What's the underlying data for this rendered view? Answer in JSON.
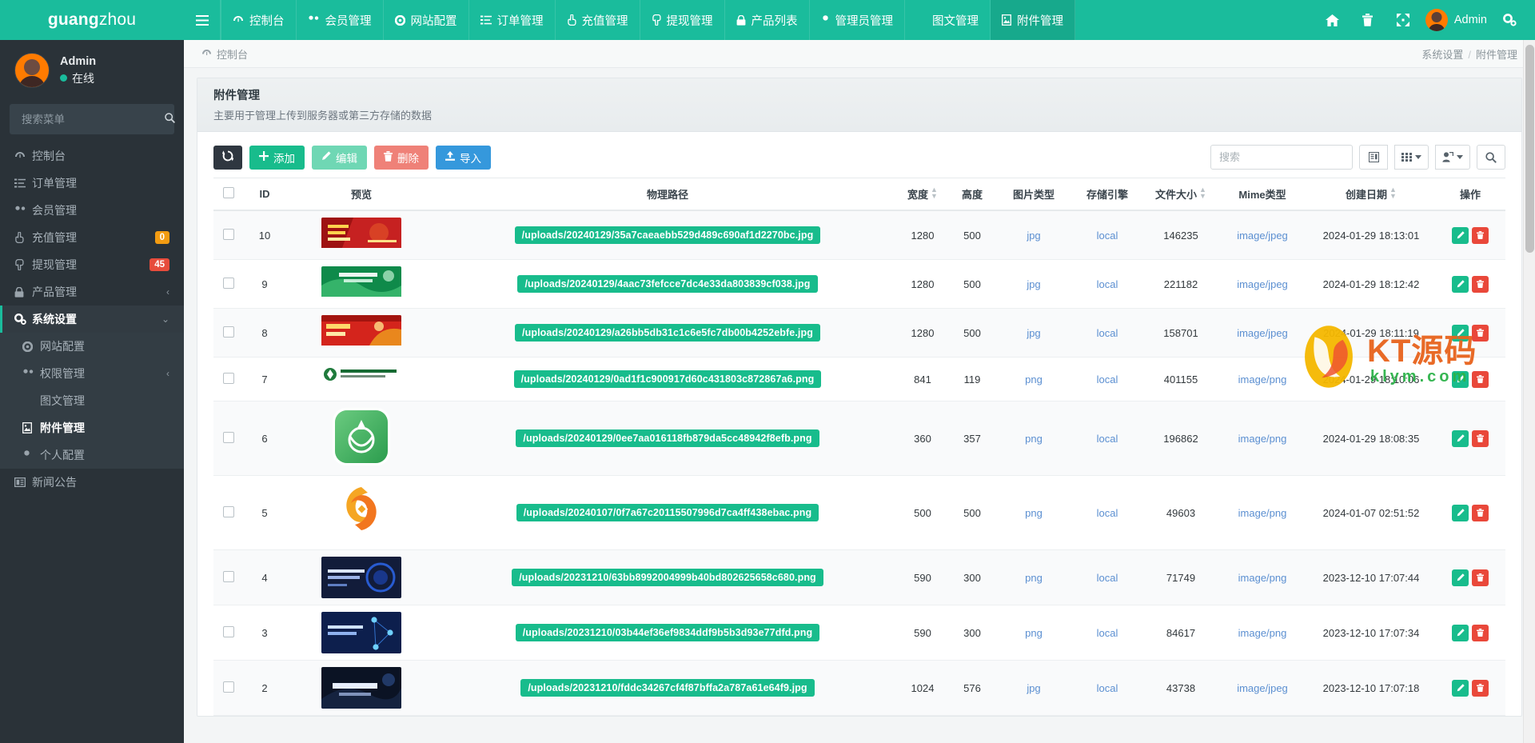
{
  "brand": {
    "bold": "guang",
    "light": "zhou"
  },
  "topnav": {
    "menu_icon": "hamburger-icon",
    "items": [
      {
        "label": "控制台",
        "icon": "dashboard-icon",
        "active": false
      },
      {
        "label": "会员管理",
        "icon": "users-icon",
        "active": false
      },
      {
        "label": "网站配置",
        "icon": "gear-icon",
        "active": false
      },
      {
        "label": "订单管理",
        "icon": "list-icon",
        "active": false
      },
      {
        "label": "充值管理",
        "icon": "hand-up-icon",
        "active": false
      },
      {
        "label": "提现管理",
        "icon": "hand-down-icon",
        "active": false
      },
      {
        "label": "产品列表",
        "icon": "lock-icon",
        "active": false
      },
      {
        "label": "管理员管理",
        "icon": "user-icon",
        "active": false
      },
      {
        "label": "图文管理",
        "icon": "leaf-icon",
        "active": false
      },
      {
        "label": "附件管理",
        "icon": "image-file-icon",
        "active": true
      }
    ],
    "right_icons": [
      "home-icon",
      "trash-icon",
      "fullscreen-icon"
    ],
    "user_name": "Admin",
    "settings_icon": "cogs-icon"
  },
  "sidebar": {
    "user": {
      "name": "Admin",
      "status": "在线"
    },
    "search_placeholder": "搜索菜单",
    "search_value": "",
    "search_icon": "search-icon",
    "items": [
      {
        "label": "控制台",
        "icon": "dashboard-icon",
        "badge": "",
        "caret": "",
        "state": ""
      },
      {
        "label": "订单管理",
        "icon": "list-icon",
        "badge": "",
        "caret": "",
        "state": ""
      },
      {
        "label": "会员管理",
        "icon": "users-icon",
        "badge": "",
        "caret": "",
        "state": ""
      },
      {
        "label": "充值管理",
        "icon": "hand-up-icon",
        "badge": "0",
        "badge_color": "#f39c12",
        "caret": "",
        "state": ""
      },
      {
        "label": "提现管理",
        "icon": "hand-down-icon",
        "badge": "45",
        "badge_color": "#e74c3c",
        "caret": "",
        "state": ""
      },
      {
        "label": "产品管理",
        "icon": "lock-icon",
        "badge": "",
        "caret": "‹",
        "state": ""
      },
      {
        "label": "系统设置",
        "icon": "cogs-icon",
        "badge": "",
        "caret": "⌄",
        "state": "active-parent"
      },
      {
        "label": "网站配置",
        "icon": "gear-icon",
        "badge": "",
        "caret": "",
        "state": "sub"
      },
      {
        "label": "权限管理",
        "icon": "users-icon",
        "badge": "",
        "caret": "‹",
        "state": "sub"
      },
      {
        "label": "图文管理",
        "icon": "leaf-icon",
        "badge": "",
        "caret": "",
        "state": "sub"
      },
      {
        "label": "附件管理",
        "icon": "image-file-icon",
        "badge": "",
        "caret": "",
        "state": "sub on"
      },
      {
        "label": "个人配置",
        "icon": "user-icon",
        "badge": "",
        "caret": "",
        "state": "sub"
      },
      {
        "label": "新闻公告",
        "icon": "news-icon",
        "badge": "",
        "caret": "",
        "state": ""
      }
    ]
  },
  "breadcrumb": {
    "left_icon": "dashboard-icon",
    "left": "控制台",
    "right_first": "系统设置",
    "right_sep": "/",
    "right_last": "附件管理"
  },
  "panel": {
    "title": "附件管理",
    "desc": "主要用于管理上传到服务器或第三方存储的数据"
  },
  "toolbar": {
    "refresh_label": "",
    "refresh_icon": "refresh-icon",
    "add_label": "添加",
    "edit_label": "编辑",
    "delete_label": "删除",
    "import_label": "导入",
    "search_placeholder": "搜索",
    "search_value": "",
    "columns_icon": "columns-icon",
    "grid_icon": "grid-icon",
    "export_icon": "export-icon",
    "search_icon": "search-icon"
  },
  "table": {
    "columns": [
      {
        "key": "check",
        "label": "",
        "sortable": false
      },
      {
        "key": "id",
        "label": "ID",
        "sortable": false
      },
      {
        "key": "preview",
        "label": "预览",
        "sortable": false
      },
      {
        "key": "path",
        "label": "物理路径",
        "sortable": false
      },
      {
        "key": "width",
        "label": "宽度",
        "sortable": true
      },
      {
        "key": "height",
        "label": "高度",
        "sortable": false
      },
      {
        "key": "imgtype",
        "label": "图片类型",
        "sortable": false
      },
      {
        "key": "engine",
        "label": "存储引擎",
        "sortable": false
      },
      {
        "key": "size",
        "label": "文件大小",
        "sortable": true
      },
      {
        "key": "mime",
        "label": "Mime类型",
        "sortable": false
      },
      {
        "key": "created",
        "label": "创建日期",
        "sortable": true
      },
      {
        "key": "op",
        "label": "操作",
        "sortable": false
      }
    ],
    "rows": [
      {
        "id": "10",
        "path": "/uploads/20240129/35a7caeaebb529d489c690af1d2270bc.jpg",
        "width": "1280",
        "height": "500",
        "imgtype": "jpg",
        "engine": "local",
        "size": "146235",
        "mime": "image/jpeg",
        "created": "2024-01-29 18:13:01",
        "thumb": "red-party-banner"
      },
      {
        "id": "9",
        "path": "/uploads/20240129/4aac73fefcce7dc4e33da803839cf038.jpg",
        "width": "1280",
        "height": "500",
        "imgtype": "jpg",
        "engine": "local",
        "size": "221182",
        "mime": "image/jpeg",
        "created": "2024-01-29 18:12:42",
        "thumb": "green-tech-banner"
      },
      {
        "id": "8",
        "path": "/uploads/20240129/a26bb5db31c1c6e5fc7db00b4252ebfe.jpg",
        "width": "1280",
        "height": "500",
        "imgtype": "jpg",
        "engine": "local",
        "size": "158701",
        "mime": "image/jpeg",
        "created": "2024-01-29 18:11:19",
        "thumb": "red-gold-banner"
      },
      {
        "id": "7",
        "path": "/uploads/20240129/0ad1f1c900917d60c431803c872867a6.png",
        "width": "841",
        "height": "119",
        "imgtype": "png",
        "engine": "local",
        "size": "401155",
        "mime": "image/png",
        "created": "2024-01-29 18:10:06",
        "thumb": "company-logo-bar"
      },
      {
        "id": "6",
        "path": "/uploads/20240129/0ee7aa016118fb879da5cc48942f8efb.png",
        "width": "360",
        "height": "357",
        "imgtype": "png",
        "engine": "local",
        "size": "196862",
        "mime": "image/png",
        "created": "2024-01-29 18:08:35",
        "thumb": "green-wreath-app-icon"
      },
      {
        "id": "5",
        "path": "/uploads/20240107/0f7a67c20115507996d7ca4ff438ebac.png",
        "width": "500",
        "height": "500",
        "imgtype": "png",
        "engine": "local",
        "size": "49603",
        "mime": "image/png",
        "created": "2024-01-07 02:51:52",
        "thumb": "orange-swirl-logo"
      },
      {
        "id": "4",
        "path": "/uploads/20231210/63bb8992004999b40bd802625658c680.png",
        "width": "590",
        "height": "300",
        "imgtype": "png",
        "engine": "local",
        "size": "71749",
        "mime": "image/png",
        "created": "2023-12-10 17:07:44",
        "thumb": "dark-blue-data-card"
      },
      {
        "id": "3",
        "path": "/uploads/20231210/03b44ef36ef9834ddf9b5b3d93e77dfd.png",
        "width": "590",
        "height": "300",
        "imgtype": "png",
        "engine": "local",
        "size": "84617",
        "mime": "image/png",
        "created": "2023-12-10 17:07:34",
        "thumb": "blue-network-card"
      },
      {
        "id": "2",
        "path": "/uploads/20231210/fddc34267cf4f87bffa2a787a61e64f9.jpg",
        "width": "1024",
        "height": "576",
        "imgtype": "jpg",
        "engine": "local",
        "size": "43738",
        "mime": "image/jpeg",
        "created": "2023-12-10 17:07:18",
        "thumb": "dark-hero-banner"
      }
    ],
    "edit_icon": "pencil-icon",
    "delete_icon": "trash-icon"
  },
  "watermark": {
    "text": "KT源码",
    "sub": "klym.com"
  }
}
